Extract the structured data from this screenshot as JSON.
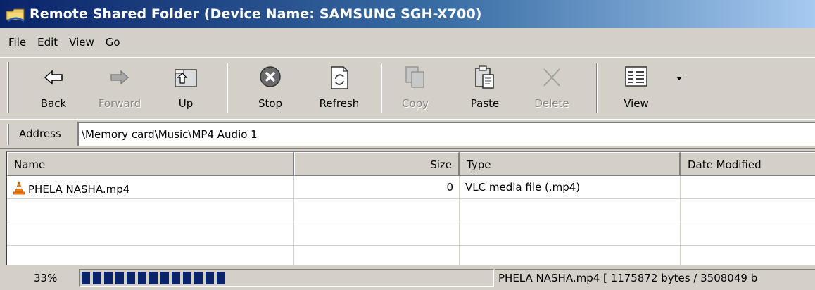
{
  "window": {
    "title": "Remote Shared Folder (Device Name: SAMSUNG SGH-X700)"
  },
  "menu": [
    "File",
    "Edit",
    "View",
    "Go"
  ],
  "toolbar": {
    "buttons": [
      {
        "label": "Back",
        "icon": "back-arrow-icon",
        "enabled": true
      },
      {
        "label": "Forward",
        "icon": "forward-arrow-icon",
        "enabled": false
      },
      {
        "label": "Up",
        "icon": "up-folder-icon",
        "enabled": true
      },
      {
        "label": "Stop",
        "icon": "stop-icon",
        "enabled": true
      },
      {
        "label": "Refresh",
        "icon": "refresh-icon",
        "enabled": true
      },
      {
        "label": "Copy",
        "icon": "copy-icon",
        "enabled": false
      },
      {
        "label": "Paste",
        "icon": "paste-icon",
        "enabled": true
      },
      {
        "label": "Delete",
        "icon": "delete-icon",
        "enabled": false
      },
      {
        "label": "View",
        "icon": "view-icon",
        "enabled": true
      }
    ]
  },
  "address": {
    "label": "Address",
    "value": "\\Memory card\\Music\\MP4 Audio 1"
  },
  "list": {
    "columns": [
      "Name",
      "Size",
      "Type",
      "Date Modified"
    ],
    "rows": [
      {
        "name": "PHELA NASHA.mp4",
        "size": "0",
        "type": "VLC media file (.mp4)",
        "date": "",
        "icon": "vlc-cone-icon"
      }
    ]
  },
  "status": {
    "percent_text": "33%",
    "progress": 0.33,
    "progress_color": "#0a246a",
    "transfer_text": "PHELA NASHA.mp4 [ 1175872 bytes / 3508049 b"
  },
  "colors": {
    "title_gradient_start": "#0a246a",
    "title_gradient_end": "#a6caf0",
    "face": "#d4d0c8"
  }
}
